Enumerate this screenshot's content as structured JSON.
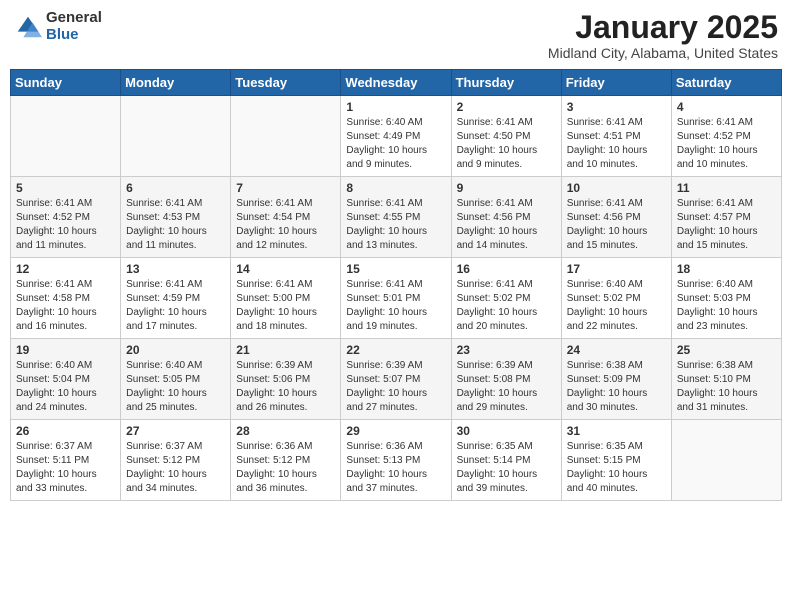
{
  "header": {
    "logo_general": "General",
    "logo_blue": "Blue",
    "title": "January 2025",
    "location": "Midland City, Alabama, United States"
  },
  "weekdays": [
    "Sunday",
    "Monday",
    "Tuesday",
    "Wednesday",
    "Thursday",
    "Friday",
    "Saturday"
  ],
  "weeks": [
    [
      {
        "day": "",
        "content": ""
      },
      {
        "day": "",
        "content": ""
      },
      {
        "day": "",
        "content": ""
      },
      {
        "day": "1",
        "content": "Sunrise: 6:40 AM\nSunset: 4:49 PM\nDaylight: 10 hours\nand 9 minutes."
      },
      {
        "day": "2",
        "content": "Sunrise: 6:41 AM\nSunset: 4:50 PM\nDaylight: 10 hours\nand 9 minutes."
      },
      {
        "day": "3",
        "content": "Sunrise: 6:41 AM\nSunset: 4:51 PM\nDaylight: 10 hours\nand 10 minutes."
      },
      {
        "day": "4",
        "content": "Sunrise: 6:41 AM\nSunset: 4:52 PM\nDaylight: 10 hours\nand 10 minutes."
      }
    ],
    [
      {
        "day": "5",
        "content": "Sunrise: 6:41 AM\nSunset: 4:52 PM\nDaylight: 10 hours\nand 11 minutes."
      },
      {
        "day": "6",
        "content": "Sunrise: 6:41 AM\nSunset: 4:53 PM\nDaylight: 10 hours\nand 11 minutes."
      },
      {
        "day": "7",
        "content": "Sunrise: 6:41 AM\nSunset: 4:54 PM\nDaylight: 10 hours\nand 12 minutes."
      },
      {
        "day": "8",
        "content": "Sunrise: 6:41 AM\nSunset: 4:55 PM\nDaylight: 10 hours\nand 13 minutes."
      },
      {
        "day": "9",
        "content": "Sunrise: 6:41 AM\nSunset: 4:56 PM\nDaylight: 10 hours\nand 14 minutes."
      },
      {
        "day": "10",
        "content": "Sunrise: 6:41 AM\nSunset: 4:56 PM\nDaylight: 10 hours\nand 15 minutes."
      },
      {
        "day": "11",
        "content": "Sunrise: 6:41 AM\nSunset: 4:57 PM\nDaylight: 10 hours\nand 15 minutes."
      }
    ],
    [
      {
        "day": "12",
        "content": "Sunrise: 6:41 AM\nSunset: 4:58 PM\nDaylight: 10 hours\nand 16 minutes."
      },
      {
        "day": "13",
        "content": "Sunrise: 6:41 AM\nSunset: 4:59 PM\nDaylight: 10 hours\nand 17 minutes."
      },
      {
        "day": "14",
        "content": "Sunrise: 6:41 AM\nSunset: 5:00 PM\nDaylight: 10 hours\nand 18 minutes."
      },
      {
        "day": "15",
        "content": "Sunrise: 6:41 AM\nSunset: 5:01 PM\nDaylight: 10 hours\nand 19 minutes."
      },
      {
        "day": "16",
        "content": "Sunrise: 6:41 AM\nSunset: 5:02 PM\nDaylight: 10 hours\nand 20 minutes."
      },
      {
        "day": "17",
        "content": "Sunrise: 6:40 AM\nSunset: 5:02 PM\nDaylight: 10 hours\nand 22 minutes."
      },
      {
        "day": "18",
        "content": "Sunrise: 6:40 AM\nSunset: 5:03 PM\nDaylight: 10 hours\nand 23 minutes."
      }
    ],
    [
      {
        "day": "19",
        "content": "Sunrise: 6:40 AM\nSunset: 5:04 PM\nDaylight: 10 hours\nand 24 minutes."
      },
      {
        "day": "20",
        "content": "Sunrise: 6:40 AM\nSunset: 5:05 PM\nDaylight: 10 hours\nand 25 minutes."
      },
      {
        "day": "21",
        "content": "Sunrise: 6:39 AM\nSunset: 5:06 PM\nDaylight: 10 hours\nand 26 minutes."
      },
      {
        "day": "22",
        "content": "Sunrise: 6:39 AM\nSunset: 5:07 PM\nDaylight: 10 hours\nand 27 minutes."
      },
      {
        "day": "23",
        "content": "Sunrise: 6:39 AM\nSunset: 5:08 PM\nDaylight: 10 hours\nand 29 minutes."
      },
      {
        "day": "24",
        "content": "Sunrise: 6:38 AM\nSunset: 5:09 PM\nDaylight: 10 hours\nand 30 minutes."
      },
      {
        "day": "25",
        "content": "Sunrise: 6:38 AM\nSunset: 5:10 PM\nDaylight: 10 hours\nand 31 minutes."
      }
    ],
    [
      {
        "day": "26",
        "content": "Sunrise: 6:37 AM\nSunset: 5:11 PM\nDaylight: 10 hours\nand 33 minutes."
      },
      {
        "day": "27",
        "content": "Sunrise: 6:37 AM\nSunset: 5:12 PM\nDaylight: 10 hours\nand 34 minutes."
      },
      {
        "day": "28",
        "content": "Sunrise: 6:36 AM\nSunset: 5:12 PM\nDaylight: 10 hours\nand 36 minutes."
      },
      {
        "day": "29",
        "content": "Sunrise: 6:36 AM\nSunset: 5:13 PM\nDaylight: 10 hours\nand 37 minutes."
      },
      {
        "day": "30",
        "content": "Sunrise: 6:35 AM\nSunset: 5:14 PM\nDaylight: 10 hours\nand 39 minutes."
      },
      {
        "day": "31",
        "content": "Sunrise: 6:35 AM\nSunset: 5:15 PM\nDaylight: 10 hours\nand 40 minutes."
      },
      {
        "day": "",
        "content": ""
      }
    ]
  ]
}
